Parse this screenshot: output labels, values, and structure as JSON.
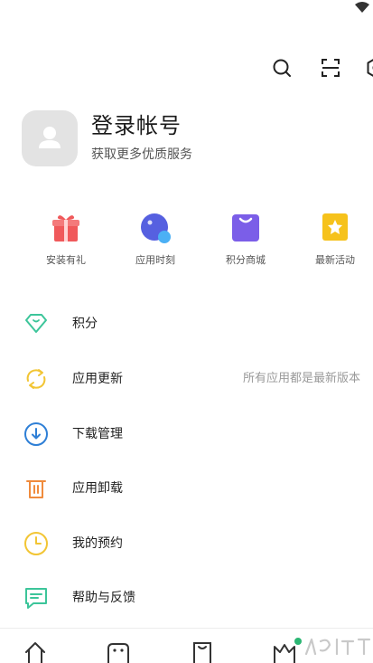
{
  "profile": {
    "title": "登录帐号",
    "subtitle": "获取更多优质服务"
  },
  "quick_links": [
    {
      "label": "安装有礼",
      "icon": "gift-icon",
      "color": "#f0595b"
    },
    {
      "label": "应用时刻",
      "icon": "app-moment-icon",
      "color": "#5660e0"
    },
    {
      "label": "积分商城",
      "icon": "shopping-bag-icon",
      "color": "#7b5ee8"
    },
    {
      "label": "最新活动",
      "icon": "activity-star-icon",
      "color": "#f6c21b"
    }
  ],
  "menu": [
    {
      "label": "积分",
      "icon": "diamond-icon",
      "color": "#3cc59a"
    },
    {
      "label": "应用更新",
      "icon": "refresh-icon",
      "color": "#f2c534",
      "status": "所有应用都是最新版本"
    },
    {
      "label": "下载管理",
      "icon": "download-icon",
      "color": "#2e7fd6"
    },
    {
      "label": "应用卸载",
      "icon": "trash-icon",
      "color": "#f08b3c"
    },
    {
      "label": "我的预约",
      "icon": "clock-icon",
      "color": "#f2c534"
    },
    {
      "label": "帮助与反馈",
      "icon": "feedback-icon",
      "color": "#3cc59a"
    }
  ],
  "header_icons": [
    "search-icon",
    "scan-icon",
    "settings-icon"
  ],
  "bottom_nav_icons": [
    "home-icon",
    "game-icon",
    "shop-icon",
    "crown-icon"
  ],
  "accent": "#2bb673"
}
